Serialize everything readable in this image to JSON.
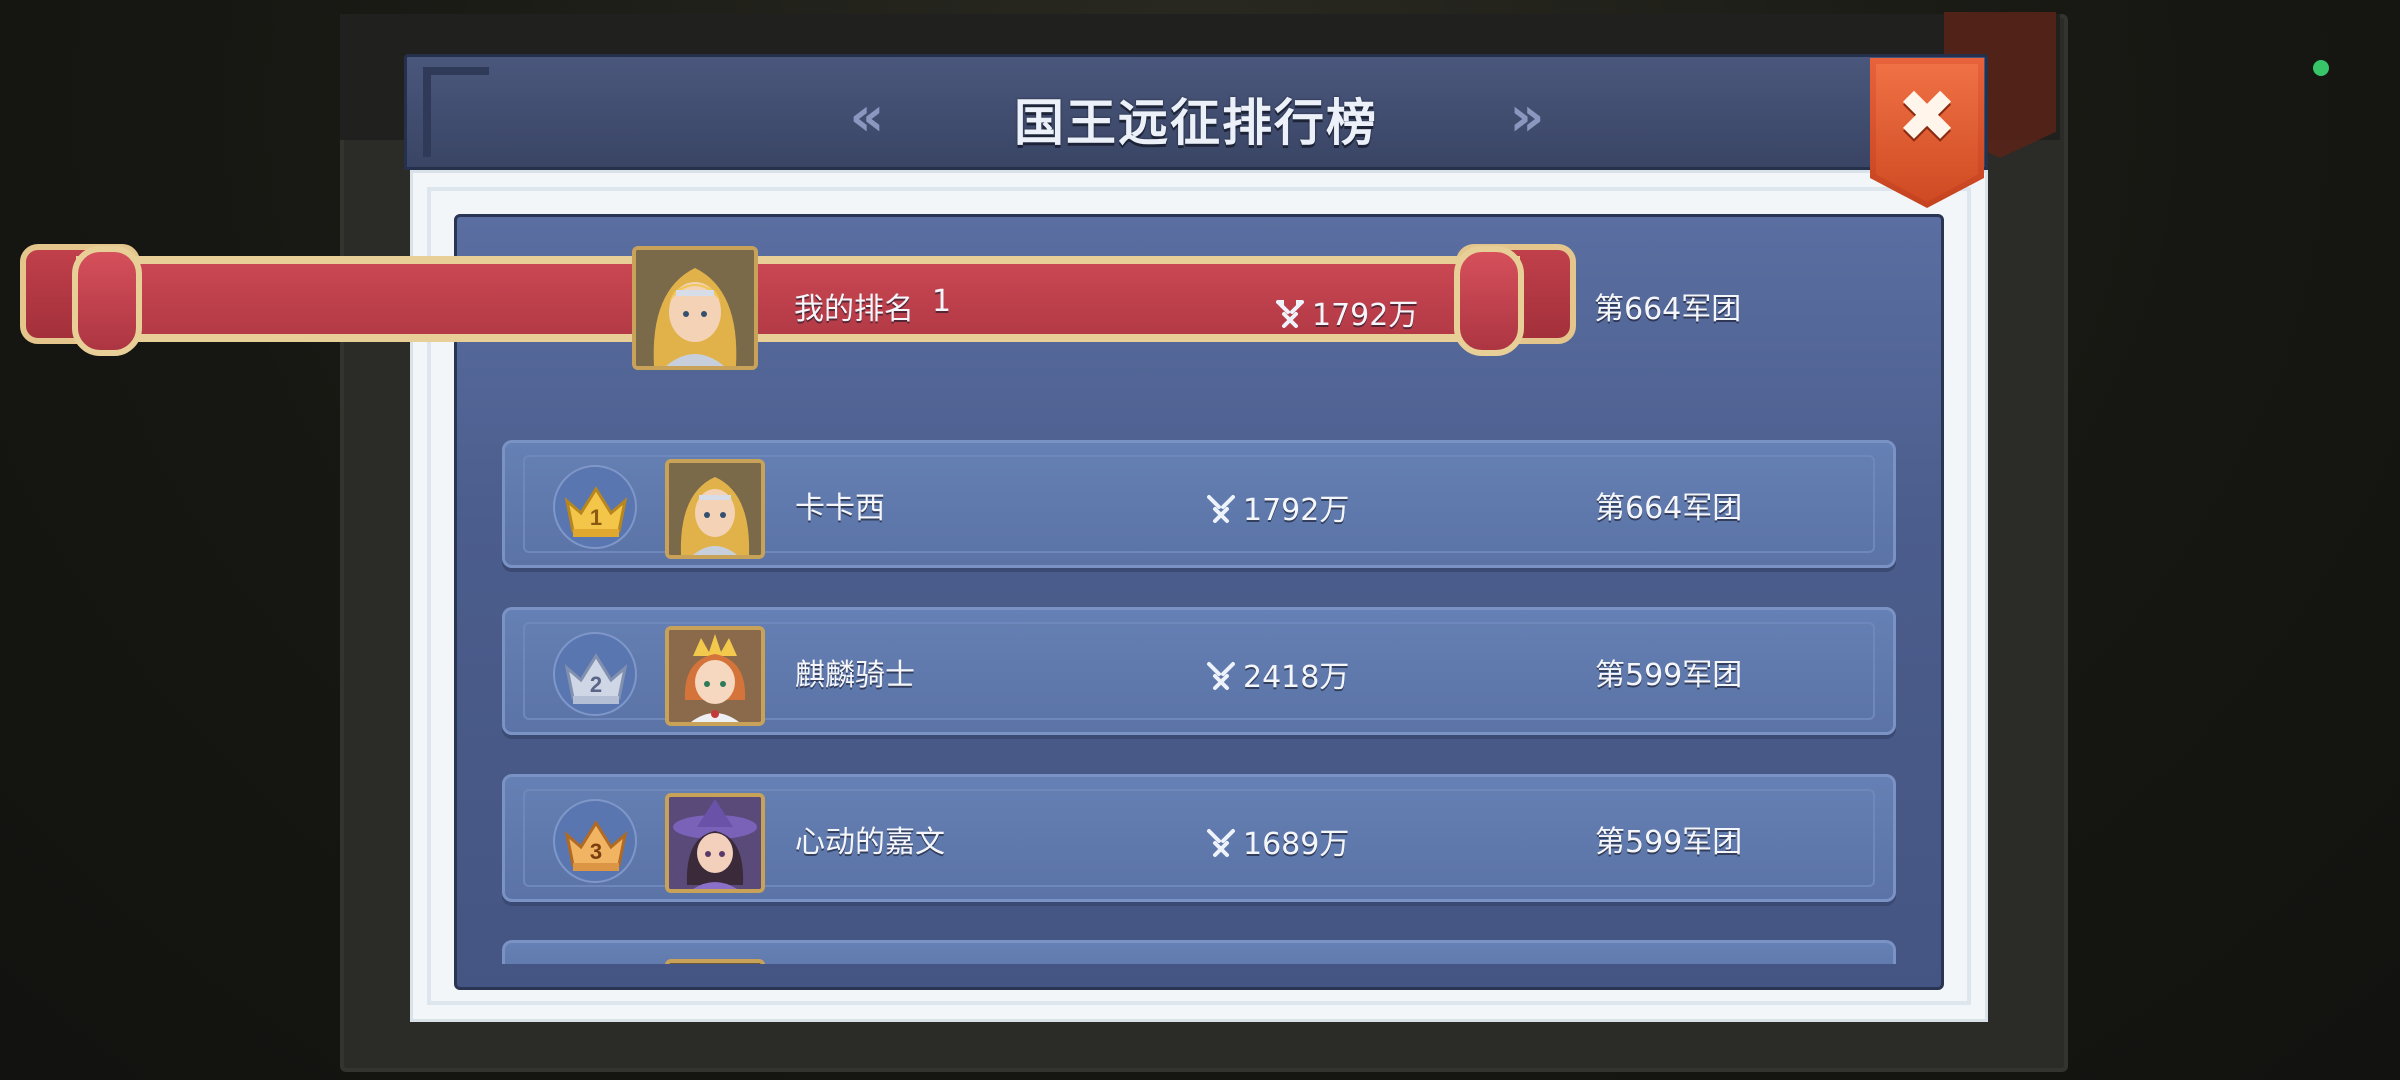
{
  "header": {
    "title": "国王远征排行榜",
    "prev_icon": "double-chevron-left-icon",
    "next_icon": "double-chevron-right-icon",
    "close_icon": "close-x-icon"
  },
  "my_rank": {
    "label": "我的排名",
    "rank": "1",
    "power": "1792万",
    "legion": "第664军团"
  },
  "rows": [
    {
      "rank": "1",
      "name": "卡卡西",
      "power": "1792万",
      "legion": "第664军团",
      "crown": "gold"
    },
    {
      "rank": "2",
      "name": "麒麟骑士",
      "power": "2418万",
      "legion": "第599军团",
      "crown": "silver"
    },
    {
      "rank": "3",
      "name": "心动的嘉文",
      "power": "1689万",
      "legion": "第599军团",
      "crown": "bronze"
    }
  ],
  "colors": {
    "accent_red": "#b33a46",
    "ribbon_gold": "#e8cf98",
    "close_orange": "#d9532b",
    "panel_blue": "#4b5d8c",
    "row_blue": "#5b73a6"
  }
}
